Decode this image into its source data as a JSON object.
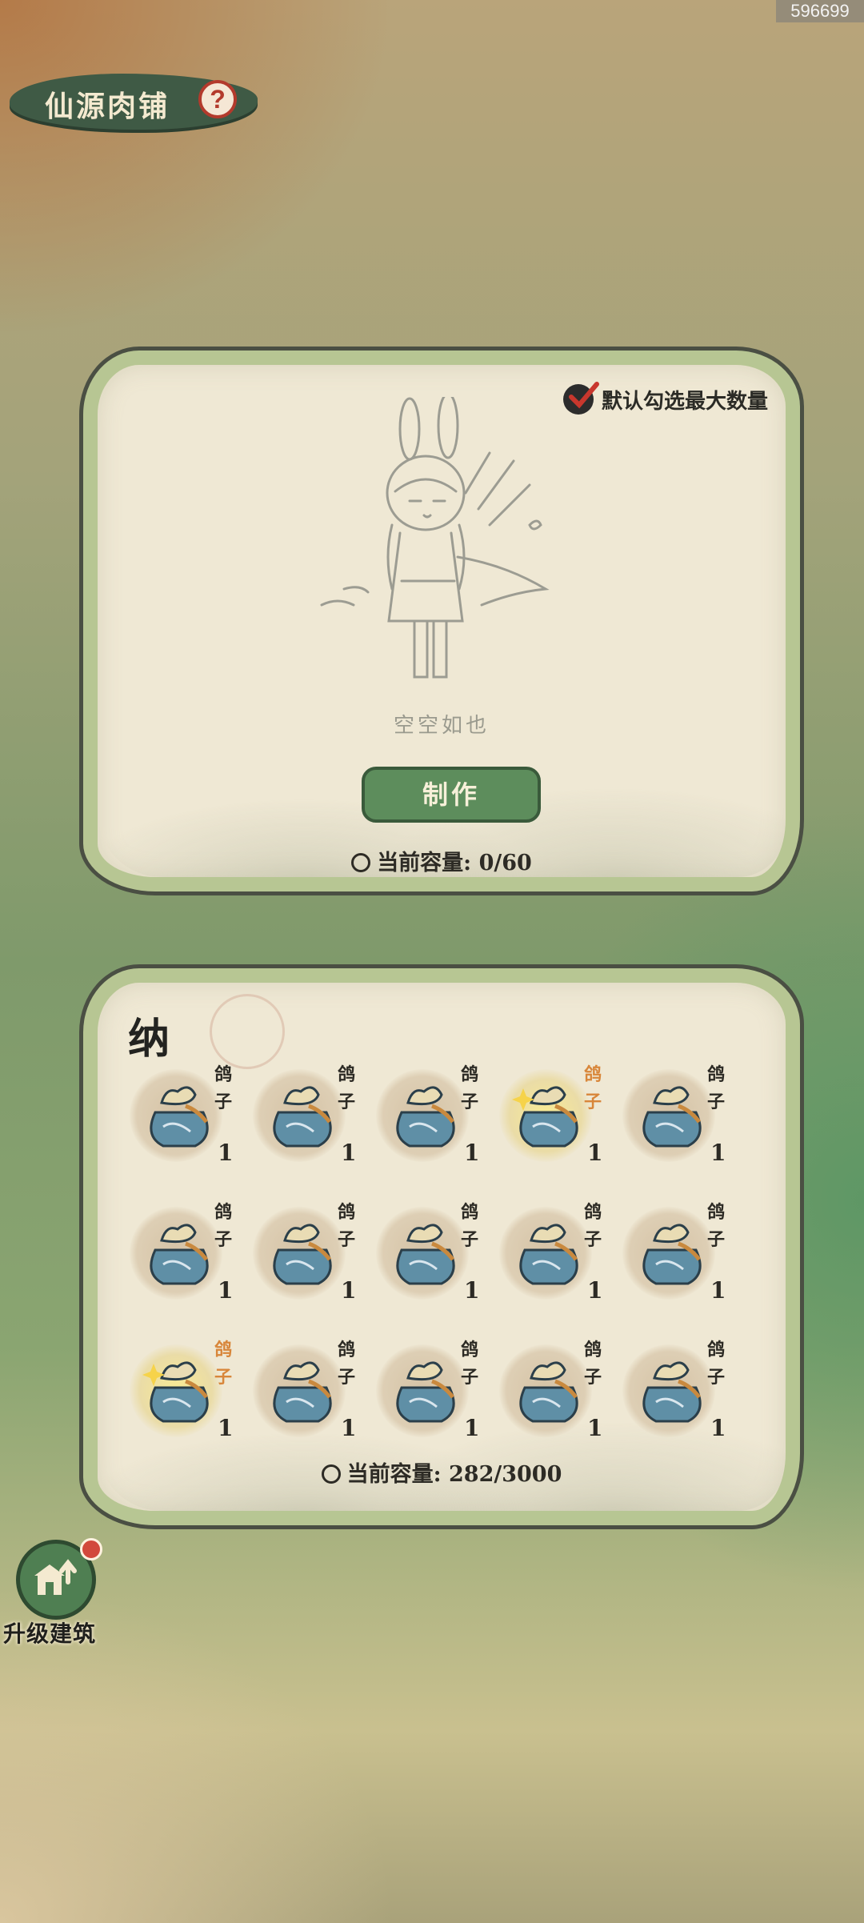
{
  "corner_id": "596699",
  "header": {
    "title": "仙源肉铺",
    "help_icon": "help-icon"
  },
  "crafting": {
    "default_select_label": "默认勾选最大数量",
    "empty_text": "空空如也",
    "make_button": "制作",
    "capacity_label": "当前容量:",
    "capacity_value": "0/60"
  },
  "storage": {
    "title": "纳",
    "items": [
      {
        "name": "鸽子",
        "qty": "1",
        "special": false
      },
      {
        "name": "鸽子",
        "qty": "1",
        "special": false
      },
      {
        "name": "鸽子",
        "qty": "1",
        "special": false
      },
      {
        "name": "鸽子",
        "qty": "1",
        "special": true
      },
      {
        "name": "鸽子",
        "qty": "1",
        "special": false
      },
      {
        "name": "鸽子",
        "qty": "1",
        "special": false
      },
      {
        "name": "鸽子",
        "qty": "1",
        "special": false
      },
      {
        "name": "鸽子",
        "qty": "1",
        "special": false
      },
      {
        "name": "鸽子",
        "qty": "1",
        "special": false
      },
      {
        "name": "鸽子",
        "qty": "1",
        "special": false
      },
      {
        "name": "鸽子",
        "qty": "1",
        "special": true
      },
      {
        "name": "鸽子",
        "qty": "1",
        "special": false
      },
      {
        "name": "鸽子",
        "qty": "1",
        "special": false
      },
      {
        "name": "鸽子",
        "qty": "1",
        "special": false
      },
      {
        "name": "鸽子",
        "qty": "1",
        "special": false
      }
    ],
    "capacity_label": "当前容量:",
    "capacity_value": "282/3000"
  },
  "upgrade": {
    "label": "升级建筑",
    "icon": "building-upgrade-icon"
  },
  "colors": {
    "panel_border": "#b7c693",
    "button_green": "#5d8d5c",
    "highlight_name": "#d8863a",
    "badge_red": "#d2493c"
  }
}
